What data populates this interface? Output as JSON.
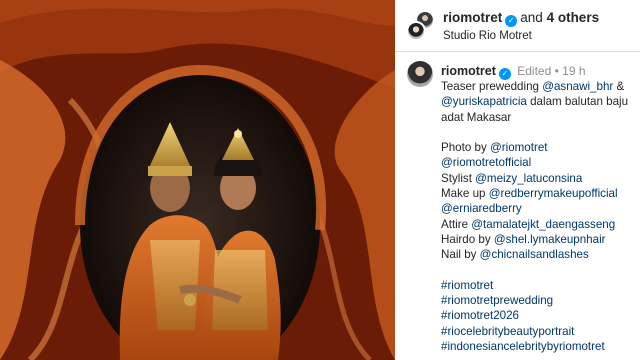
{
  "header": {
    "username": "riomotret",
    "and_text": "and",
    "others": "4 others",
    "location": "Studio Rio Motret"
  },
  "caption": {
    "username": "riomotret",
    "edited": "Edited",
    "separator": "•",
    "time": "19 h",
    "intro": {
      "prefix": "Teaser prewedding ",
      "mention1": "@asnawi_bhr",
      "amp": " &",
      "mention2": "@yuriskapatricia",
      "rest1": " dalam balutan baju",
      "rest2": "adat Makasar"
    },
    "credits": [
      {
        "label": "Photo by ",
        "handle": "@riomotret"
      },
      {
        "label": "",
        "handle": "@riomotretofficial"
      },
      {
        "label": "Stylist ",
        "handle": "@meizy_latuconsina"
      },
      {
        "label": "Make up ",
        "handle": "@redberrymakeupofficial"
      },
      {
        "label": "",
        "handle": "@erniaredberry"
      },
      {
        "label": "Attire ",
        "handle": "@tamalatejkt_daengasseng"
      },
      {
        "label": "Hairdo by ",
        "handle": "@shel.lymakeupnhair"
      },
      {
        "label": "Nail by ",
        "handle": "@chicnailsandlashes"
      }
    ],
    "hashtags": [
      "#riomotret",
      "#riomotretprewedding",
      "#riomotret2026",
      "#riocelebritybeautyportrait",
      "#indonesiancelebritybyriomotret"
    ]
  },
  "colors": {
    "verified": "#0095f6",
    "link": "#00376b",
    "muted": "#8e8e8e",
    "fabric": "#b24a1c"
  }
}
